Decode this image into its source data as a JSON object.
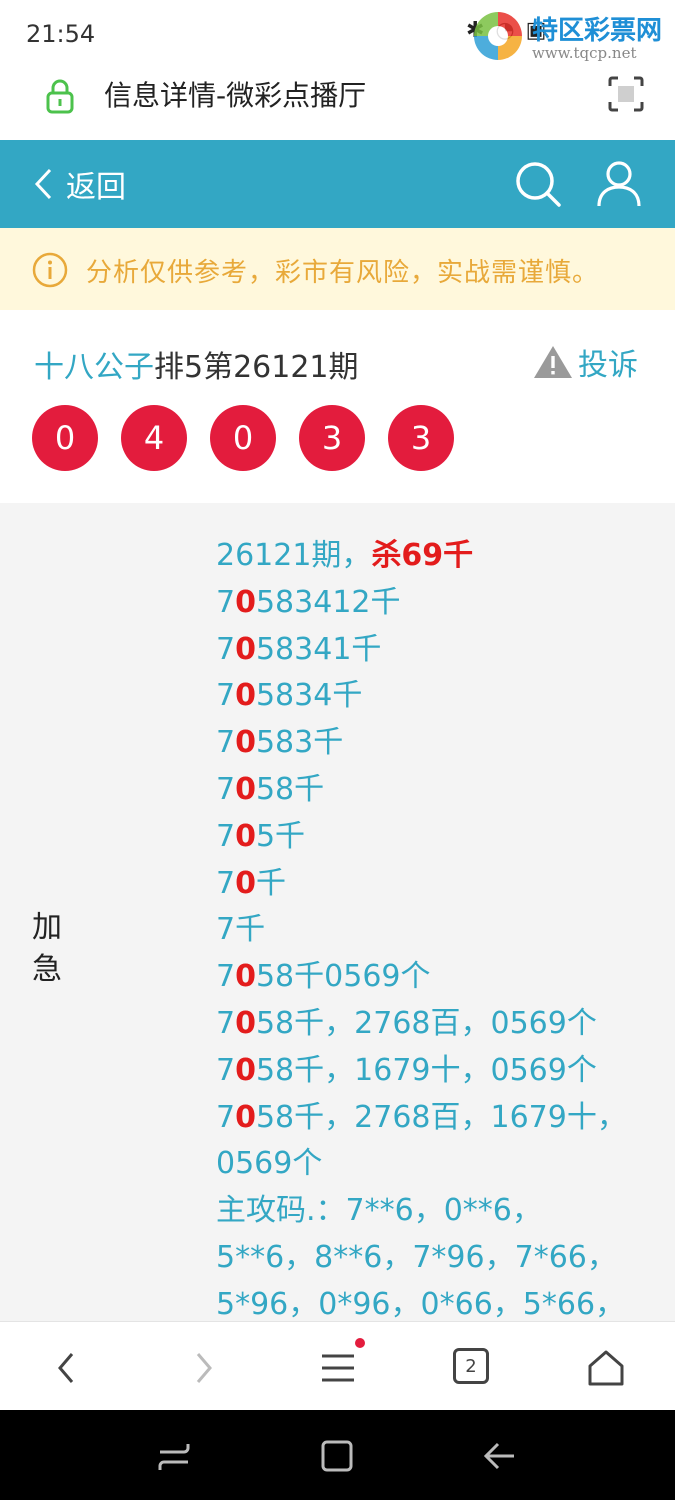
{
  "status": {
    "time": "21:54",
    "icons": "✱ ◔ ▣"
  },
  "watermark": {
    "brand": "特区彩票网",
    "url": "www.tqcp.net"
  },
  "browser": {
    "title": "信息详情-微彩点播厅",
    "tab_count": "2"
  },
  "nav": {
    "back_label": "返回"
  },
  "notice": {
    "text": "分析仅供参考，彩市有风险，实战需谨慎。"
  },
  "post": {
    "author": "十八公子",
    "issue_text": "排5第26121期",
    "complaint_label": "投诉",
    "balls": [
      "0",
      "4",
      "0",
      "3",
      "3"
    ]
  },
  "content": {
    "label": "加急",
    "lines": [
      {
        "a": "26121期，",
        "r": "杀69千",
        "b": ""
      },
      {
        "a": "7",
        "r": "0",
        "b": "583412千"
      },
      {
        "a": "7",
        "r": "0",
        "b": "58341千"
      },
      {
        "a": "7",
        "r": "0",
        "b": "5834千"
      },
      {
        "a": "7",
        "r": "0",
        "b": "583千"
      },
      {
        "a": "7",
        "r": "0",
        "b": "58千"
      },
      {
        "a": "7",
        "r": "0",
        "b": "5千"
      },
      {
        "a": "7",
        "r": "0",
        "b": "千"
      },
      {
        "a": "7千",
        "r": "",
        "b": ""
      },
      {
        "a": "7",
        "r": "0",
        "b": "58千0569个"
      },
      {
        "a": "7",
        "r": "0",
        "b": "58千，2768百，0569个"
      },
      {
        "a": "7",
        "r": "0",
        "b": "58千，1679十，0569个"
      },
      {
        "a": "7",
        "r": "0",
        "b": "58千，2768百，1679十，0569个"
      },
      {
        "a": "主攻码.：7**6，0**6，5**6，8**6，7*96，7*66，5*96，0*96，0*66，5*66，",
        "r": "",
        "b": ""
      }
    ]
  }
}
